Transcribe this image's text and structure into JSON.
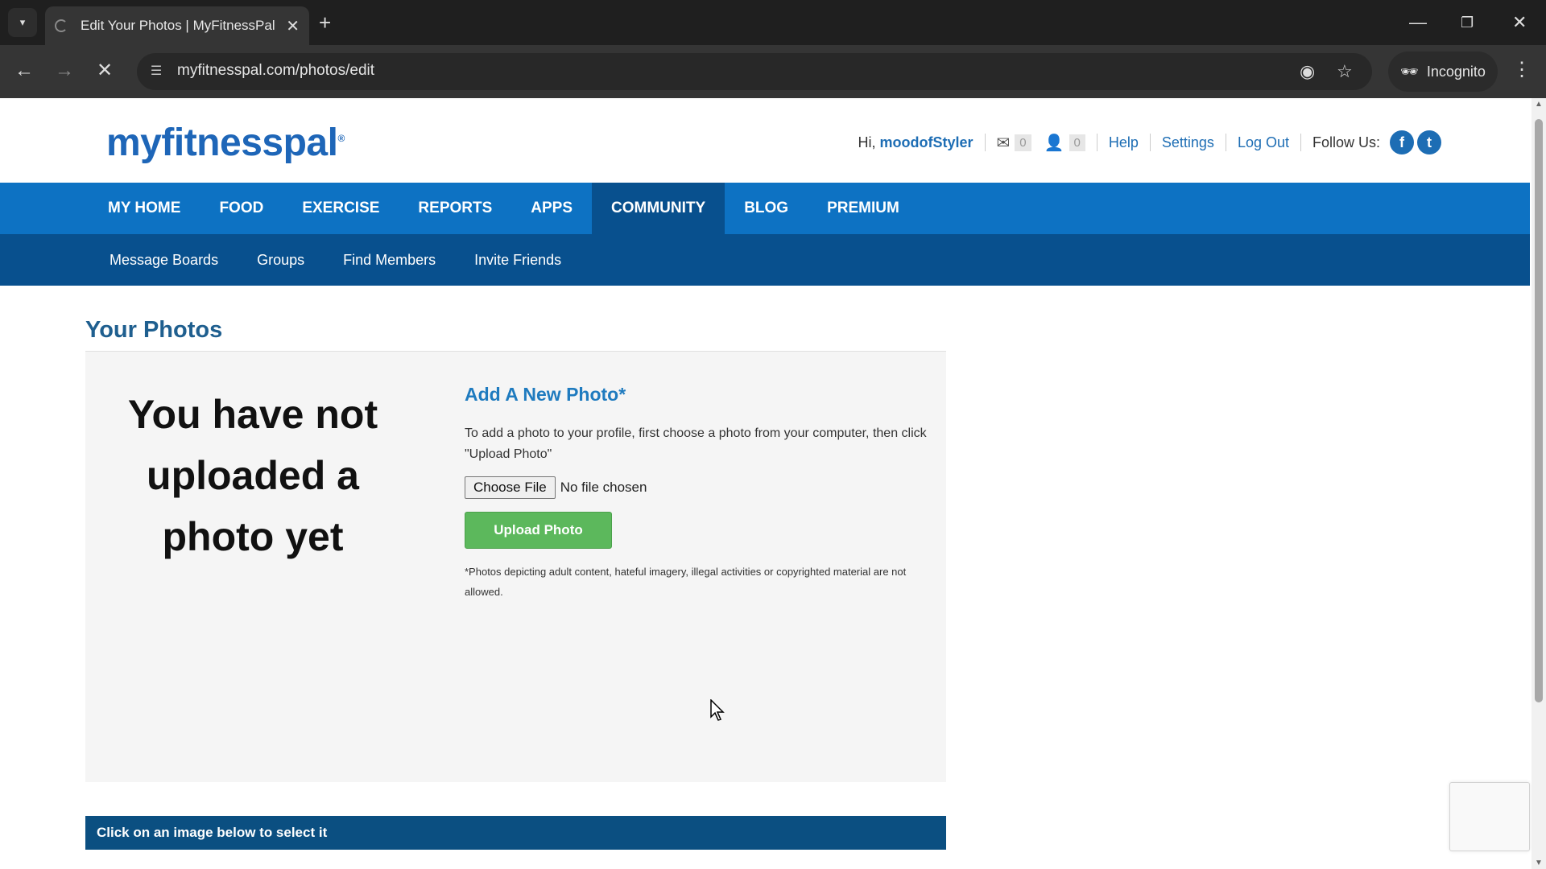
{
  "browser": {
    "tab_title": "Edit Your Photos | MyFitnessPal",
    "url": "myfitnesspal.com/photos/edit",
    "incognito_label": "Incognito"
  },
  "header": {
    "logo": "myfitnesspal",
    "greeting_prefix": "Hi,",
    "username": "moodofStyler",
    "messages_count": "0",
    "friends_count": "0",
    "help": "Help",
    "settings": "Settings",
    "logout": "Log Out",
    "follow_us": "Follow Us:"
  },
  "main_nav": [
    "MY HOME",
    "FOOD",
    "EXERCISE",
    "REPORTS",
    "APPS",
    "COMMUNITY",
    "BLOG",
    "PREMIUM"
  ],
  "main_nav_active": "COMMUNITY",
  "sub_nav": [
    "Message Boards",
    "Groups",
    "Find Members",
    "Invite Friends"
  ],
  "page": {
    "title": "Your Photos",
    "no_photo_message": "You have not uploaded a photo yet",
    "add_title": "Add A New Photo*",
    "add_description": "To add a photo to your profile, first choose a photo from your computer, then click \"Upload Photo\"",
    "choose_file_label": "Choose File",
    "file_status": "No file chosen",
    "upload_button": "Upload Photo",
    "disclaimer": "*Photos depicting adult content, hateful imagery, illegal activities or copyrighted material are not allowed.",
    "select_instruction": "Click on an image below to select it"
  },
  "colors": {
    "brand_blue": "#0d72c3",
    "nav_dark": "#08508e",
    "upload_green": "#5cb85c"
  }
}
